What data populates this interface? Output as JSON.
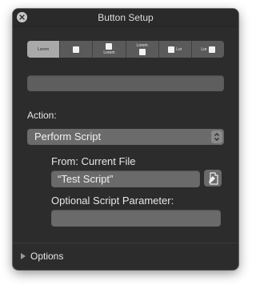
{
  "window": {
    "title": "Button Setup"
  },
  "segments": [
    {
      "label": "Lorem",
      "layout": "text-only",
      "selected": true
    },
    {
      "label": "",
      "layout": "icon-only",
      "selected": false
    },
    {
      "label": "Lorem",
      "layout": "icon-top-text-bottom",
      "selected": false
    },
    {
      "label": "Lorem",
      "layout": "text-top-icon-bottom",
      "selected": false
    },
    {
      "label": "Lor",
      "layout": "icon-left-text-right",
      "selected": false
    },
    {
      "label": "Lor",
      "layout": "text-left-icon-right",
      "selected": false
    }
  ],
  "button_label_field": {
    "value": ""
  },
  "action": {
    "label": "Action:",
    "selected": "Perform Script",
    "from_label": "From: Current File",
    "script_value": "“Test Script”",
    "parameter_label": "Optional Script Parameter:",
    "parameter_value": ""
  },
  "options": {
    "label": "Options"
  }
}
